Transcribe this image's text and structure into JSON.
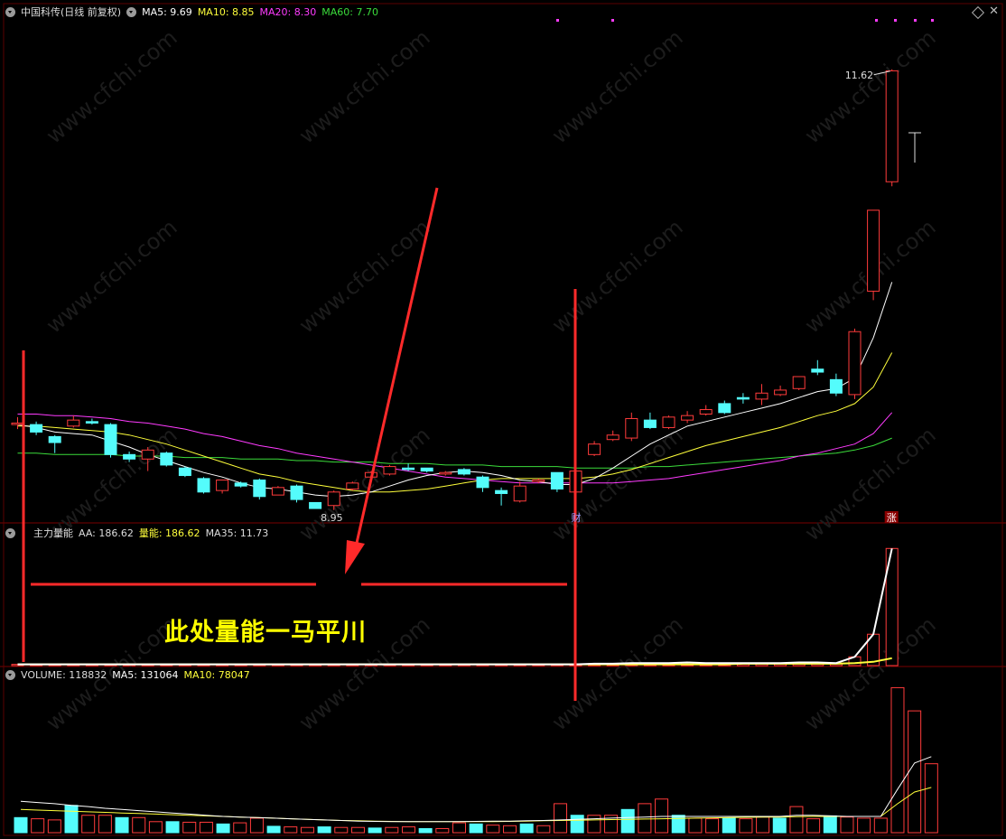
{
  "header_main": {
    "title": "中国科传(日线 前复权)",
    "ma5": "MA5: 9.69",
    "ma10": "MA10: 8.85",
    "ma20": "MA20: 8.30",
    "ma60": "MA60: 7.70"
  },
  "header_energy": {
    "name": "主力量能",
    "aa": "AA: 186.62",
    "liang": "量能: 186.62",
    "ma35": "MA35: 11.73"
  },
  "header_volume": {
    "volume": "VOLUME: 118832",
    "ma5": "MA5: 131064",
    "ma10": "MA10: 78047"
  },
  "annotation_text": "此处量能一马平川",
  "labels": {
    "high": "11.62",
    "low": "8.95",
    "cai_marker": "财",
    "zhang_marker": "涨",
    "watermark": "www.cfchi.com"
  },
  "colors": {
    "up": "#ff3b3b",
    "down": "#54fcfc",
    "ma5": "#ffffff",
    "ma10": "#ffff3b",
    "ma20": "#ff3bff",
    "ma60": "#3bdc3b",
    "annotation": "#ff2a2a"
  },
  "chart_data": {
    "type": "candlestick",
    "price_range": [
      8.6,
      11.95
    ],
    "candles": [
      [
        9.25,
        9.26,
        9.3,
        9.22
      ],
      [
        9.25,
        9.2,
        9.27,
        9.18
      ],
      [
        9.17,
        9.13,
        9.18,
        9.06
      ],
      [
        9.24,
        9.28,
        9.31,
        9.23
      ],
      [
        9.27,
        9.26,
        9.29,
        9.25
      ],
      [
        9.25,
        9.05,
        9.26,
        9.03
      ],
      [
        9.05,
        9.02,
        9.07,
        9.0
      ],
      [
        9.02,
        9.08,
        9.1,
        8.94
      ],
      [
        9.06,
        8.98,
        9.07,
        8.97
      ],
      [
        8.96,
        8.91,
        8.97,
        8.9
      ],
      [
        8.89,
        8.8,
        8.9,
        8.79
      ],
      [
        8.81,
        8.88,
        8.88,
        8.79
      ],
      [
        8.86,
        8.84,
        8.87,
        8.83
      ],
      [
        8.88,
        8.77,
        8.89,
        8.75
      ],
      [
        8.78,
        8.83,
        8.84,
        8.78
      ],
      [
        8.84,
        8.75,
        8.85,
        8.73
      ],
      [
        8.73,
        8.69,
        8.73,
        8.69
      ],
      [
        8.71,
        8.8,
        8.81,
        8.68
      ],
      [
        8.82,
        8.86,
        8.87,
        8.81
      ],
      [
        8.9,
        8.93,
        8.94,
        8.89
      ],
      [
        8.92,
        8.97,
        8.98,
        8.91
      ],
      [
        8.96,
        8.95,
        8.99,
        8.94
      ],
      [
        8.96,
        8.94,
        8.96,
        8.93
      ],
      [
        8.92,
        8.93,
        8.94,
        8.91
      ],
      [
        8.95,
        8.92,
        8.96,
        8.91
      ],
      [
        8.9,
        8.83,
        8.91,
        8.8
      ],
      [
        8.81,
        8.79,
        8.83,
        8.71
      ],
      [
        8.74,
        8.84,
        8.87,
        8.73
      ],
      [
        8.87,
        8.88,
        8.89,
        8.86
      ],
      [
        8.93,
        8.82,
        8.93,
        8.8
      ],
      [
        8.8,
        8.94,
        8.95,
        8.8
      ],
      [
        9.05,
        9.12,
        9.14,
        9.04
      ],
      [
        9.15,
        9.18,
        9.21,
        9.14
      ],
      [
        9.16,
        9.29,
        9.33,
        9.14
      ],
      [
        9.28,
        9.23,
        9.33,
        9.22
      ],
      [
        9.23,
        9.3,
        9.31,
        9.22
      ],
      [
        9.28,
        9.31,
        9.34,
        9.26
      ],
      [
        9.32,
        9.35,
        9.38,
        9.31
      ],
      [
        9.39,
        9.33,
        9.41,
        9.32
      ],
      [
        9.43,
        9.42,
        9.46,
        9.39
      ],
      [
        9.42,
        9.46,
        9.52,
        9.38
      ],
      [
        9.45,
        9.48,
        9.51,
        9.44
      ],
      [
        9.49,
        9.57,
        9.57,
        9.48
      ],
      [
        9.62,
        9.6,
        9.68,
        9.58
      ],
      [
        9.55,
        9.46,
        9.59,
        9.44
      ],
      [
        9.45,
        9.87,
        9.89,
        9.42
      ],
      [
        10.14,
        10.68,
        10.68,
        10.08
      ],
      [
        10.87,
        11.61,
        11.62,
        10.84
      ]
    ],
    "ma5": [
      9.25,
      9.23,
      9.2,
      9.19,
      9.18,
      9.14,
      9.1,
      9.05,
      9.01,
      8.97,
      8.93,
      8.9,
      8.86,
      8.83,
      8.82,
      8.8,
      8.78,
      8.77,
      8.78,
      8.8,
      8.84,
      8.88,
      8.91,
      8.93,
      8.94,
      8.93,
      8.91,
      8.88,
      8.87,
      8.85,
      8.85,
      8.89,
      8.96,
      9.04,
      9.12,
      9.18,
      9.24,
      9.27,
      9.3,
      9.33,
      9.36,
      9.39,
      9.43,
      9.47,
      9.49,
      9.56,
      9.83,
      10.2
    ],
    "ma10": [
      9.24,
      9.24,
      9.23,
      9.22,
      9.21,
      9.2,
      9.18,
      9.15,
      9.12,
      9.08,
      9.04,
      9.0,
      8.96,
      8.92,
      8.9,
      8.87,
      8.85,
      8.83,
      8.81,
      8.8,
      8.8,
      8.81,
      8.82,
      8.84,
      8.86,
      8.88,
      8.89,
      8.89,
      8.89,
      8.89,
      8.89,
      8.9,
      8.92,
      8.95,
      8.99,
      9.03,
      9.07,
      9.11,
      9.14,
      9.17,
      9.2,
      9.23,
      9.27,
      9.31,
      9.34,
      9.39,
      9.5,
      9.73
    ],
    "ma20": [
      9.32,
      9.32,
      9.31,
      9.31,
      9.3,
      9.29,
      9.27,
      9.26,
      9.24,
      9.22,
      9.19,
      9.17,
      9.14,
      9.11,
      9.09,
      9.06,
      9.04,
      9.02,
      9.0,
      8.98,
      8.96,
      8.94,
      8.92,
      8.9,
      8.89,
      8.88,
      8.87,
      8.86,
      8.86,
      8.86,
      8.86,
      8.86,
      8.86,
      8.87,
      8.88,
      8.89,
      8.91,
      8.93,
      8.95,
      8.97,
      8.99,
      9.01,
      9.04,
      9.06,
      9.09,
      9.12,
      9.19,
      9.33
    ],
    "ma60": [
      9.06,
      9.06,
      9.05,
      9.05,
      9.05,
      9.05,
      9.04,
      9.04,
      9.04,
      9.03,
      9.03,
      9.03,
      9.02,
      9.02,
      9.02,
      9.01,
      9.01,
      9.0,
      9.0,
      9.0,
      8.99,
      8.99,
      8.99,
      8.98,
      8.98,
      8.98,
      8.97,
      8.97,
      8.97,
      8.97,
      8.96,
      8.96,
      8.96,
      8.96,
      8.97,
      8.97,
      8.98,
      8.99,
      9.0,
      9.01,
      9.02,
      9.03,
      9.04,
      9.05,
      9.06,
      9.08,
      9.11,
      9.16
    ],
    "energy_range": [
      0,
      200
    ],
    "energy": [
      2,
      2,
      2,
      2,
      2,
      2,
      2,
      2,
      2,
      2,
      2,
      2,
      2,
      2,
      2,
      2,
      2,
      2,
      2,
      2,
      2,
      2,
      2,
      2,
      2,
      2,
      2,
      2,
      2,
      2,
      2,
      3,
      3,
      4,
      4,
      4,
      5,
      4,
      4,
      4,
      4,
      4,
      5,
      5,
      4,
      14,
      50,
      186.62
    ],
    "energy_ma35": [
      2,
      2,
      2,
      2,
      2,
      2,
      2,
      2,
      2,
      2,
      2,
      2,
      2,
      2,
      2,
      2,
      2,
      2,
      2,
      2,
      2,
      2,
      2,
      2,
      2,
      2,
      2,
      2,
      2,
      2,
      2,
      2,
      2,
      2,
      2,
      2,
      2,
      2,
      2,
      3,
      3,
      3,
      3,
      3,
      3,
      4,
      6,
      11.73
    ],
    "volume_range": [
      0,
      260000
    ],
    "volume": [
      26000,
      24000,
      22000,
      47000,
      30000,
      30000,
      26000,
      26000,
      19000,
      19000,
      18000,
      18000,
      15000,
      17000,
      25000,
      11000,
      10000,
      9000,
      10000,
      9000,
      9000,
      8000,
      9000,
      10000,
      7000,
      7000,
      17000,
      15000,
      13000,
      12000,
      15000,
      12000,
      50000,
      30000,
      30000,
      30000,
      40000,
      50000,
      58000,
      30000,
      25000,
      24000,
      25000,
      24000,
      27000,
      25000,
      45000,
      24000,
      29000,
      27000,
      25000,
      25000,
      250000,
      210000,
      118832
    ],
    "volume_ma5": [
      54000,
      52000,
      50000,
      47000,
      45000,
      42000,
      40000,
      38000,
      36000,
      34000,
      32000,
      30000,
      28000,
      27000,
      26000,
      25000,
      24000,
      23000,
      22000,
      21000,
      20000,
      19500,
      19000,
      19000,
      19000,
      19000,
      19000,
      19500,
      20000,
      20000,
      20500,
      21000,
      22000,
      23000,
      24000,
      25000,
      26000,
      27000,
      28000,
      28000,
      28000,
      28000,
      28000,
      28000,
      28000,
      28000,
      30000,
      30000,
      29000,
      28000,
      28000,
      28000,
      75000,
      120000,
      131064
    ],
    "volume_ma10": [
      40000,
      39000,
      38000,
      37000,
      36000,
      35000,
      34000,
      33000,
      32000,
      31000,
      30000,
      29000,
      28000,
      27000,
      26000,
      25000,
      24000,
      23000,
      22000,
      21000,
      20500,
      20000,
      19500,
      19000,
      19000,
      19000,
      19000,
      19000,
      19000,
      19500,
      20000,
      20500,
      21000,
      21500,
      22000,
      22500,
      23000,
      23500,
      24000,
      24500,
      25000,
      25500,
      26000,
      26500,
      27000,
      27000,
      27500,
      28000,
      28000,
      28000,
      28000,
      28000,
      50000,
      70000,
      78047
    ]
  }
}
